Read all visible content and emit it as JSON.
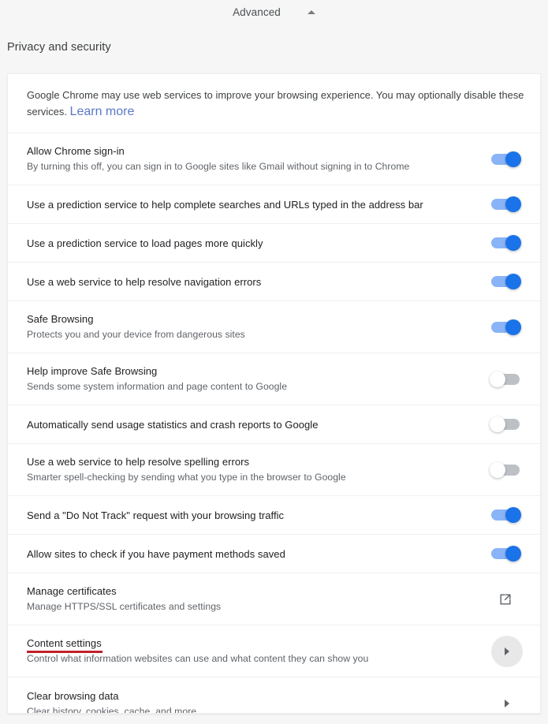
{
  "advanced": {
    "label": "Advanced",
    "chevron_icon": "chevron-up-icon"
  },
  "section": {
    "title": "Privacy and security"
  },
  "colors": {
    "page_background": "#f6f6f6",
    "card_background": "#ffffff",
    "toggle_on_track": "#8ab4f8",
    "toggle_on_knob": "#1a73e8",
    "toggle_off_track": "#bdc1c6",
    "toggle_off_knob": "#ffffff",
    "link": "#5b77c7",
    "annotation_underline": "#c0202a",
    "hover_circle": "#e8e8e8"
  },
  "intro": {
    "text_before_link": "Google Chrome may use web services to improve your browsing experience. You may optionally disable these services. ",
    "link_label": "Learn more"
  },
  "rows": [
    {
      "title": "Allow Chrome sign-in",
      "subtitle": "By turning this off, you can sign in to Google sites like Gmail without signing in to Chrome",
      "control": "toggle",
      "state": "on"
    },
    {
      "title": "Use a prediction service to help complete searches and URLs typed in the address bar",
      "subtitle": "",
      "control": "toggle",
      "state": "on"
    },
    {
      "title": "Use a prediction service to load pages more quickly",
      "subtitle": "",
      "control": "toggle",
      "state": "on"
    },
    {
      "title": "Use a web service to help resolve navigation errors",
      "subtitle": "",
      "control": "toggle",
      "state": "on"
    },
    {
      "title": "Safe Browsing",
      "subtitle": "Protects you and your device from dangerous sites",
      "control": "toggle",
      "state": "on"
    },
    {
      "title": "Help improve Safe Browsing",
      "subtitle": "Sends some system information and page content to Google",
      "control": "toggle",
      "state": "off"
    },
    {
      "title": "Automatically send usage statistics and crash reports to Google",
      "subtitle": "",
      "control": "toggle",
      "state": "off"
    },
    {
      "title": "Use a web service to help resolve spelling errors",
      "subtitle": "Smarter spell-checking by sending what you type in the browser to Google",
      "control": "toggle",
      "state": "off"
    },
    {
      "title": "Send a \"Do Not Track\" request with your browsing traffic",
      "subtitle": "",
      "control": "toggle",
      "state": "on"
    },
    {
      "title": "Allow sites to check if you have payment methods saved",
      "subtitle": "",
      "control": "toggle",
      "state": "on"
    },
    {
      "title": "Manage certificates",
      "subtitle": "Manage HTTPS/SSL certificates and settings",
      "control": "external-link",
      "state": ""
    },
    {
      "title": "Content settings",
      "subtitle": "Control what information websites can use and what content they can show you",
      "control": "arrow",
      "state": "hovered",
      "annotated": true
    },
    {
      "title": "Clear browsing data",
      "subtitle": "Clear history, cookies, cache, and more",
      "control": "arrow",
      "state": ""
    }
  ]
}
